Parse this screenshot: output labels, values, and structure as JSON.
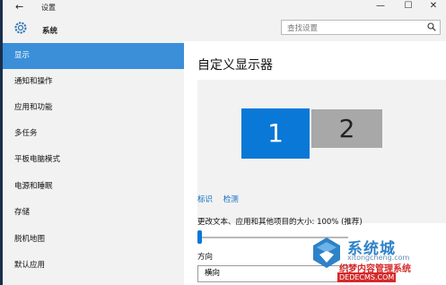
{
  "window": {
    "title": "设置",
    "back_icon": "←",
    "minimize_icon": "—",
    "maximize_icon": "☐",
    "close_icon": "✕"
  },
  "header": {
    "app_title": "系统",
    "search_placeholder": "查找设置"
  },
  "sidebar": {
    "items": [
      {
        "label": "显示",
        "active": true
      },
      {
        "label": "通知和操作",
        "active": false
      },
      {
        "label": "应用和功能",
        "active": false
      },
      {
        "label": "多任务",
        "active": false
      },
      {
        "label": "平板电脑模式",
        "active": false
      },
      {
        "label": "电源和睡眠",
        "active": false
      },
      {
        "label": "存储",
        "active": false
      },
      {
        "label": "脱机地图",
        "active": false
      },
      {
        "label": "默认应用",
        "active": false
      }
    ]
  },
  "main": {
    "title": "自定义显示器",
    "monitors": [
      {
        "label": "1",
        "selected": true
      },
      {
        "label": "2",
        "selected": false
      }
    ],
    "identify_link": "标识",
    "detect_link": "检测",
    "scale_label": "更改文本、应用和其他项目的大小: 100% (推荐)",
    "scale_value_fraction": 0,
    "orientation_label": "方向",
    "orientation_value": "横向"
  },
  "watermark": {
    "brand_text": "系统城",
    "url_text": "xitongcheng.com",
    "site_name": "织梦内容管理系统",
    "site_url": "DEDECMS.COM"
  },
  "colors": {
    "accent": "#0a78d7",
    "nav_active": "#3a8fd8",
    "link": "#0d6ac4"
  }
}
